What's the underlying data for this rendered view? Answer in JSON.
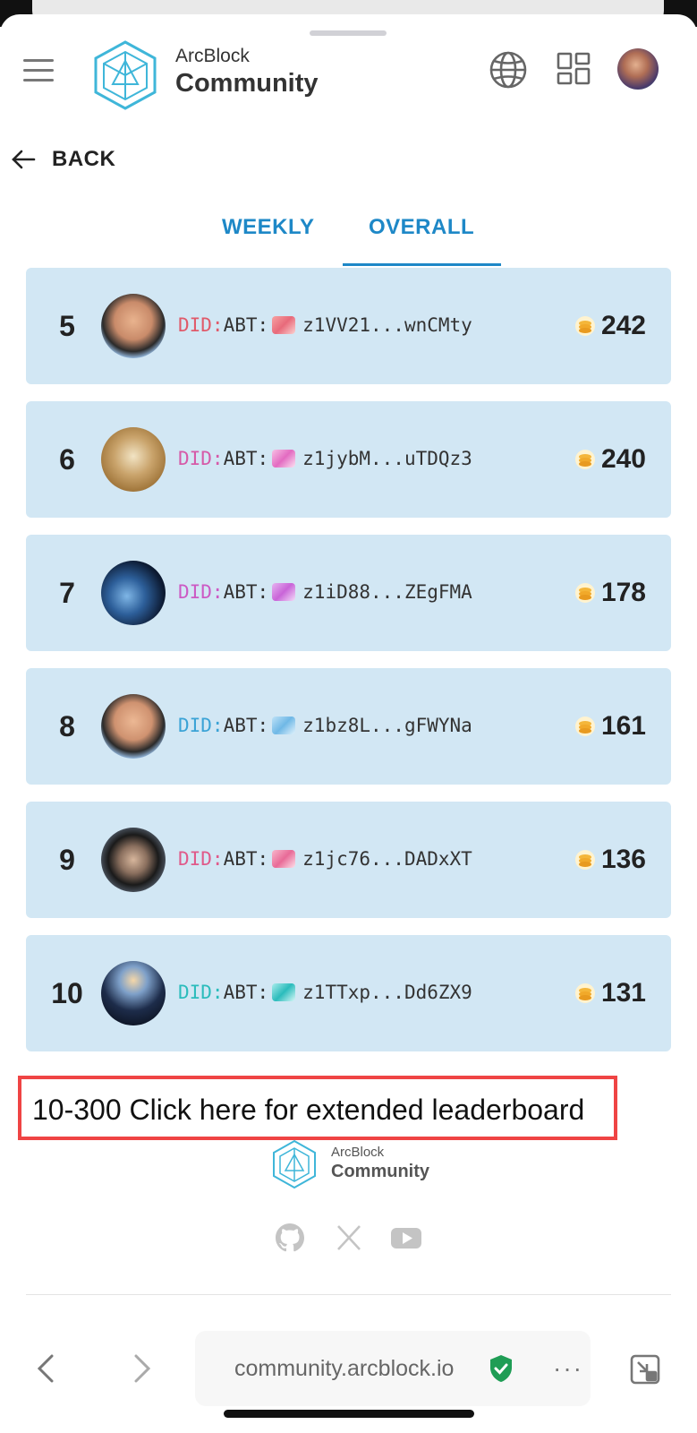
{
  "header": {
    "logo_top": "ArcBlock",
    "logo_bottom": "Community",
    "icons": [
      "menu-icon",
      "globe-icon",
      "apps-grid-icon",
      "user-avatar"
    ]
  },
  "back": {
    "label": "BACK"
  },
  "tabs": [
    {
      "label": "WEEKLY",
      "active": false
    },
    {
      "label": "OVERALL",
      "active": true
    }
  ],
  "colors": {
    "accent": "#1e88c7",
    "row_bg": "#d2e7f4",
    "highlight_border": "#ef4444"
  },
  "leaderboard": [
    {
      "rank": "5",
      "did_prefix": "DID:",
      "did_abt": "ABT:",
      "did_color": "#e05a6a",
      "address": "z1VV21...wnCMty",
      "score": "242"
    },
    {
      "rank": "6",
      "did_prefix": "DID:",
      "did_abt": "ABT:",
      "did_color": "#d65aa8",
      "address": "z1jybM...uTDQz3",
      "score": "240"
    },
    {
      "rank": "7",
      "did_prefix": "DID:",
      "did_abt": "ABT:",
      "did_color": "#cc5ac4",
      "address": "z1iD88...ZEgFMA",
      "score": "178"
    },
    {
      "rank": "8",
      "did_prefix": "DID:",
      "did_abt": "ABT:",
      "did_color": "#3ba3d6",
      "address": "z1bz8L...gFWYNa",
      "score": "161"
    },
    {
      "rank": "9",
      "did_prefix": "DID:",
      "did_abt": "ABT:",
      "did_color": "#e05a8a",
      "address": "z1jc76...DADxXT",
      "score": "136"
    },
    {
      "rank": "10",
      "did_prefix": "DID:",
      "did_abt": "ABT:",
      "did_color": "#2bbcbc",
      "address": "z1TTxp...Dd6ZX9",
      "score": "131"
    }
  ],
  "extended": {
    "label": "10-300 Click here for extended leaderboard"
  },
  "footer": {
    "logo_top": "ArcBlock",
    "logo_bottom": "Community",
    "social": [
      "github-icon",
      "x-icon",
      "youtube-icon"
    ]
  },
  "browser": {
    "url": "community.arcblock.io",
    "more": "···"
  }
}
